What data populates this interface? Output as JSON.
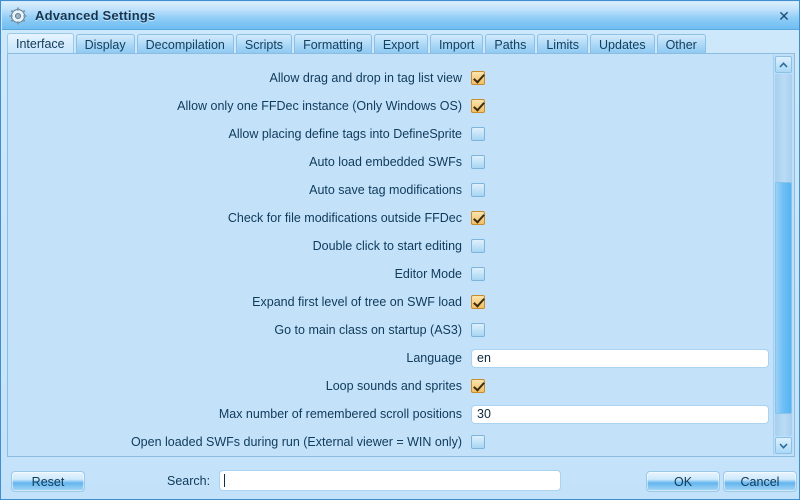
{
  "window": {
    "title": "Advanced Settings",
    "icon": "gear-icon",
    "close_label": "✕"
  },
  "tabs": [
    {
      "label": "Interface",
      "selected": true
    },
    {
      "label": "Display",
      "selected": false
    },
    {
      "label": "Decompilation",
      "selected": false
    },
    {
      "label": "Scripts",
      "selected": false
    },
    {
      "label": "Formatting",
      "selected": false
    },
    {
      "label": "Export",
      "selected": false
    },
    {
      "label": "Import",
      "selected": false
    },
    {
      "label": "Paths",
      "selected": false
    },
    {
      "label": "Limits",
      "selected": false
    },
    {
      "label": "Updates",
      "selected": false
    },
    {
      "label": "Other",
      "selected": false
    }
  ],
  "settings": [
    {
      "label": "Allow drag and drop in tag list view",
      "type": "checkbox",
      "checked": true
    },
    {
      "label": "Allow only one FFDec instance (Only Windows OS)",
      "type": "checkbox",
      "checked": true
    },
    {
      "label": "Allow placing define tags into DefineSprite",
      "type": "checkbox",
      "checked": false
    },
    {
      "label": "Auto load embedded SWFs",
      "type": "checkbox",
      "checked": false
    },
    {
      "label": "Auto save tag modifications",
      "type": "checkbox",
      "checked": false
    },
    {
      "label": "Check for file modifications outside FFDec",
      "type": "checkbox",
      "checked": true
    },
    {
      "label": "Double click to start editing",
      "type": "checkbox",
      "checked": false
    },
    {
      "label": "Editor Mode",
      "type": "checkbox",
      "checked": false
    },
    {
      "label": "Expand first level of tree on SWF load",
      "type": "checkbox",
      "checked": true
    },
    {
      "label": "Go to main class on startup (AS3)",
      "type": "checkbox",
      "checked": false
    },
    {
      "label": "Language",
      "type": "text",
      "value": "en"
    },
    {
      "label": "Loop sounds and sprites",
      "type": "checkbox",
      "checked": true
    },
    {
      "label": "Max number of remembered scroll positions",
      "type": "text",
      "value": "30"
    },
    {
      "label": "Open loaded SWFs during run (External viewer = WIN only)",
      "type": "checkbox",
      "checked": false
    }
  ],
  "scrollbar": {
    "up_arrow": "chevron-up-icon",
    "down_arrow": "chevron-down-icon"
  },
  "footer": {
    "reset_label": "Reset",
    "search_label": "Search:",
    "search_value": "",
    "search_placeholder": "",
    "ok_label": "OK",
    "cancel_label": "Cancel"
  },
  "colors": {
    "window_bg": "#c3e2fa",
    "title_accent": "#6fbdf2",
    "checked_box": "#f3bf63",
    "unchecked_box": "#a8d5f3",
    "text": "#0f3a5a"
  }
}
